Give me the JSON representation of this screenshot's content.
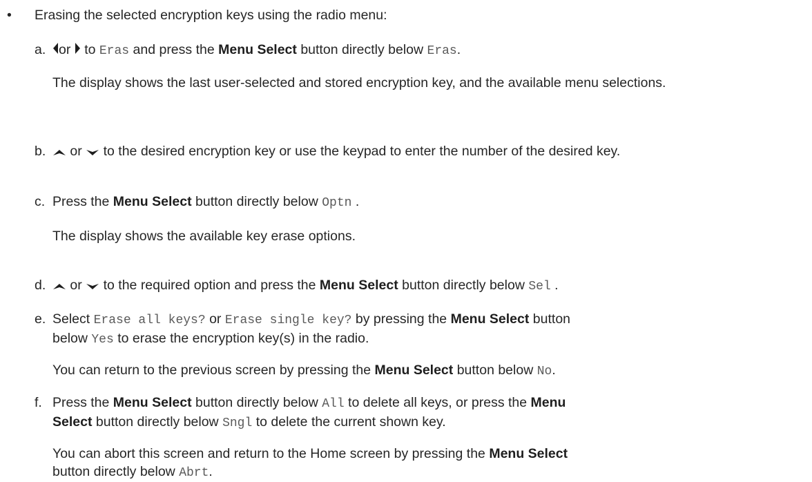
{
  "intro": {
    "bullet": "•",
    "text": "Erasing the selected encryption keys using the radio menu:"
  },
  "common": {
    "menu_select": "Menu Select",
    "menu": "Menu",
    "select": "Select",
    "or": "or"
  },
  "steps": {
    "a": {
      "letter": "a.",
      "t1": "to",
      "code1": "Eras",
      "t2": "and press the",
      "t3": "button directly below",
      "code2": "Eras",
      "t4": ".",
      "note": "The display shows the last user-selected and stored encryption key, and the available menu selections."
    },
    "b": {
      "letter": "b.",
      "t1": "to the desired encryption key or use the keypad to enter the number of the desired key."
    },
    "c": {
      "letter": "c.",
      "t1": "Press the",
      "t2": "button directly below",
      "code1": "Optn",
      "t3": ".",
      "note": "The display shows the available key erase options."
    },
    "d": {
      "letter": "d.",
      "t1": "to the required option and press the",
      "t2": "button directly below",
      "code1": "Sel",
      "t3": "."
    },
    "e": {
      "letter": "e.",
      "t1": "Select",
      "code1": "Erase all keys?",
      "t2": "or",
      "code2": "Erase single key?",
      "t3": "by pressing the",
      "t4": "button",
      "t5": "below",
      "code3": "Yes",
      "t6": "to erase the encryption key(s) in the radio.",
      "note1": "You can return to the previous screen by pressing the",
      "note2": "button below",
      "code4": "No",
      "note3": "."
    },
    "f": {
      "letter": "f.",
      "t1": "Press the",
      "t2": "button directly below",
      "code1": "All",
      "t3": "to delete all keys, or press the",
      "t4": "button directly below",
      "code2": "Sngl",
      "t5": "to delete the current shown key.",
      "note1": "You can abort this screen and return to the Home screen by pressing the",
      "note2": "button directly below",
      "code3": "Abrt",
      "note3": "."
    }
  },
  "icons": [
    "left-arrow-icon",
    "right-arrow-icon",
    "up-arrow-icon",
    "down-arrow-icon"
  ]
}
